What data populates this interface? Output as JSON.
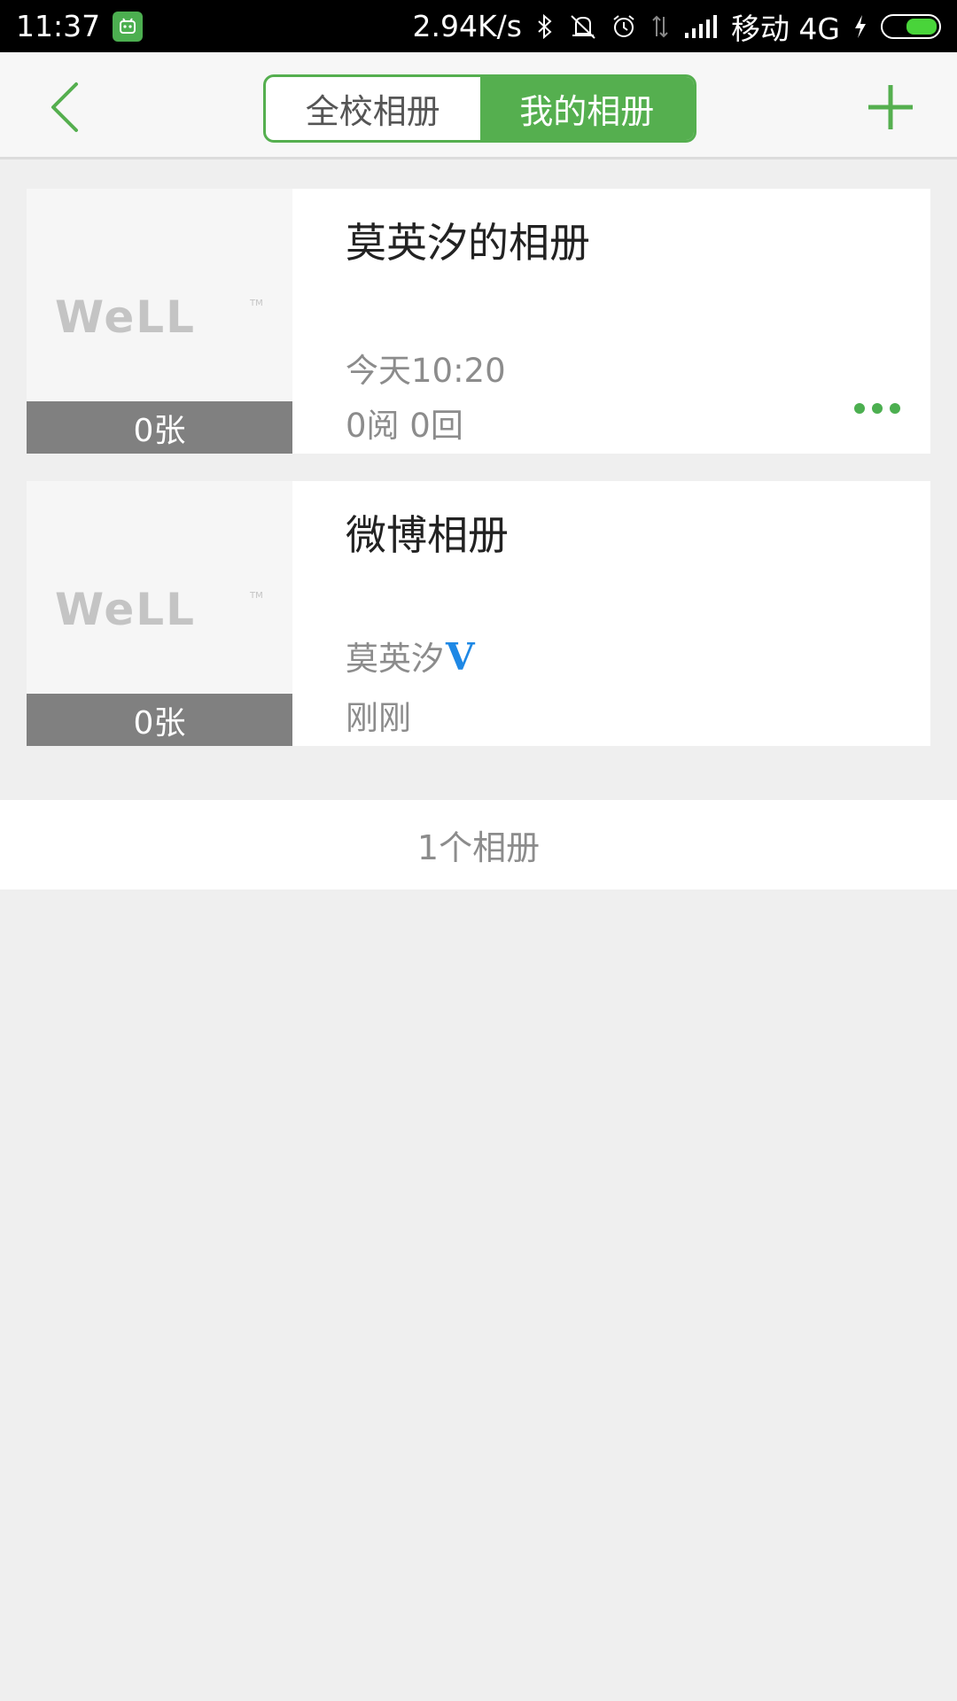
{
  "status_bar": {
    "time": "11:37",
    "net_speed": "2.94K/s",
    "carrier": "移动 4G",
    "icons": [
      "notification-app-icon",
      "bluetooth-icon",
      "vibrate-off-icon",
      "alarm-icon",
      "data-transfer-icon",
      "signal-icon",
      "charging-icon",
      "battery-icon"
    ]
  },
  "header": {
    "tabs": [
      {
        "label": "全校相册",
        "active": false
      },
      {
        "label": "我的相册",
        "active": true
      }
    ],
    "accent_color": "#55af4f"
  },
  "albums": [
    {
      "title": "莫英汐的相册",
      "count": "0张",
      "time": "今天10:20",
      "stats": "0阅 0回",
      "cover_logo": "well-logo"
    },
    {
      "title": "微博相册",
      "count": "0张",
      "owner": "莫英汐",
      "verified_badge": "V",
      "time": "刚刚",
      "cover_logo": "well-logo"
    }
  ],
  "footer": {
    "album_count": "1个相册"
  }
}
